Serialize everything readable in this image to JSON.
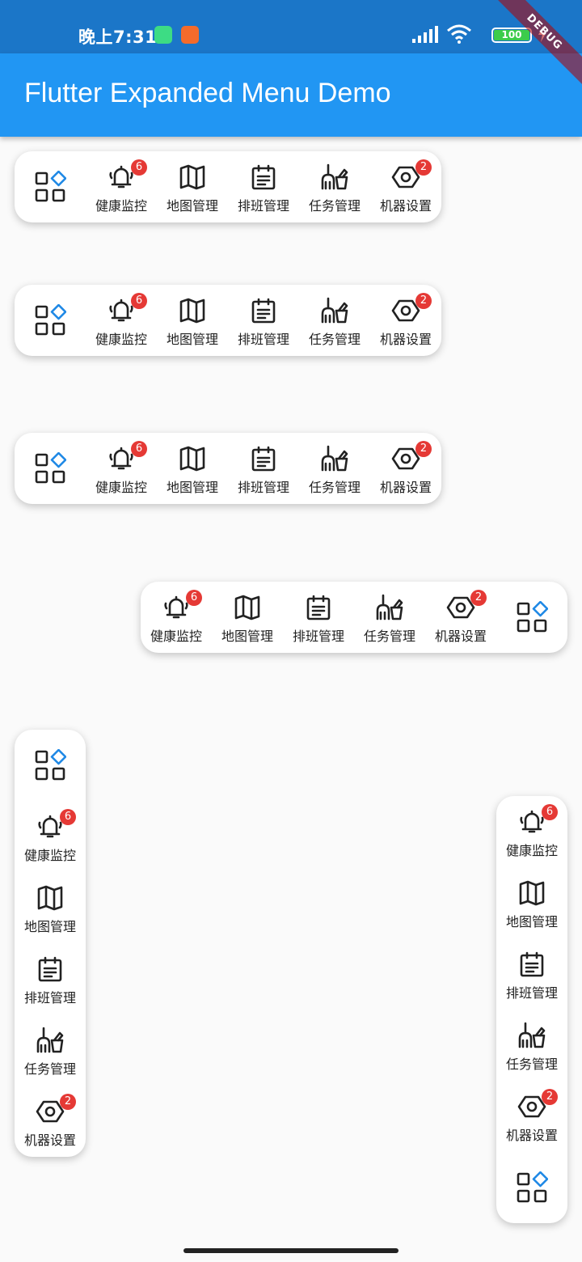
{
  "status_bar": {
    "time": "晚上7:31",
    "battery_level": "100",
    "battery_fill_color": "#3ccc4b",
    "icons": [
      "android-icon",
      "camera-icon",
      "signal-icon",
      "wifi-icon",
      "battery-icon",
      "charging-icon"
    ]
  },
  "debug_banner": "DEBUG",
  "app_bar": {
    "title": "Flutter Expanded Menu Demo",
    "color": "#2196f3"
  },
  "menu_items": [
    {
      "label": "健康监控",
      "icon": "bell-icon",
      "badge": "6"
    },
    {
      "label": "地图管理",
      "icon": "map-icon",
      "badge": ""
    },
    {
      "label": "排班管理",
      "icon": "calendar-icon",
      "badge": ""
    },
    {
      "label": "任务管理",
      "icon": "cleaning-icon",
      "badge": ""
    },
    {
      "label": "机器设置",
      "icon": "nut-icon",
      "badge": "2"
    }
  ],
  "menu_toggle_icon": "grid-menu-icon",
  "badge_color": "#e53935",
  "accent_color": "#1e88e5"
}
